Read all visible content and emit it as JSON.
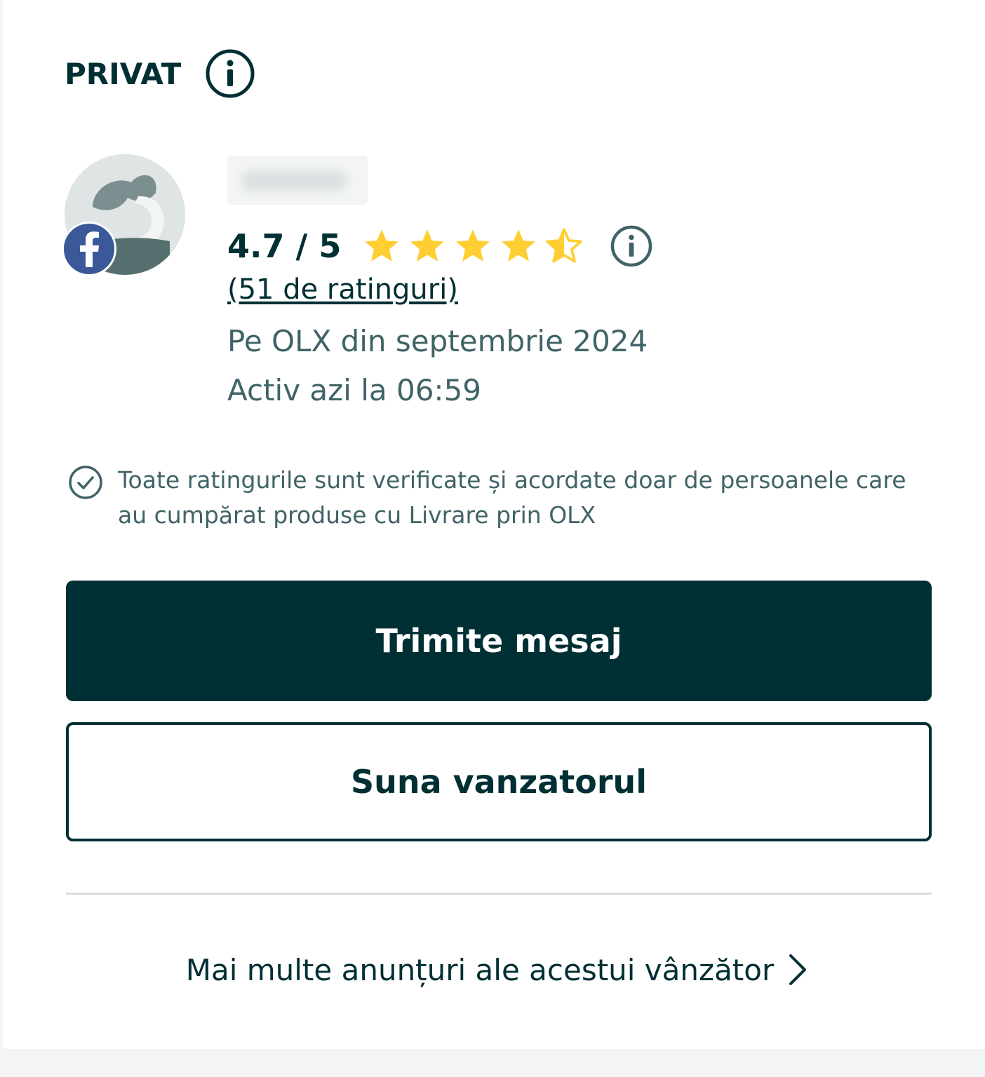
{
  "seller": {
    "type_label": "PRIVAT",
    "rating_text": "4.7 / 5",
    "rating_value": 4.7,
    "rating_max": 5,
    "ratings_count_link": "(51 de ratinguri)",
    "member_since": "Pe OLX din septembrie 2024",
    "last_active": "Activ azi la 06:59",
    "verified_notice": "Toate ratingurile sunt verificate și acordate doar de persoanele care au cumpărat produse cu Livrare prin OLX"
  },
  "actions": {
    "send_message_label": "Trimite mesaj",
    "call_seller_label": "Suna vanzatorul",
    "more_ads_label": "Mai multe anunțuri ale acestui vânzător"
  },
  "icons": {
    "info": "info-icon",
    "star": "star-icon",
    "facebook": "facebook-icon",
    "check": "check-circle-icon",
    "chevron": "chevron-right-icon"
  },
  "colors": {
    "primary": "#002f34",
    "star": "#ffce32",
    "facebook": "#3b5998",
    "muted_text": "#406367"
  }
}
